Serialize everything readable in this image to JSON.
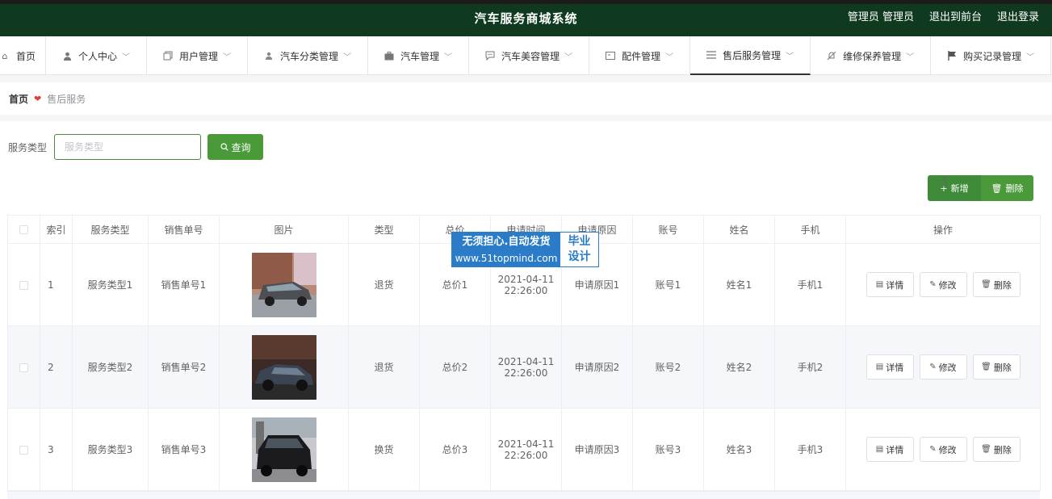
{
  "header": {
    "title": "汽车服务商城系统",
    "user_label": "管理员 管理员",
    "back_label": "退出到前台",
    "logout_label": "退出登录"
  },
  "nav": [
    {
      "label": "首页",
      "icon": "home-icon"
    },
    {
      "label": "个人中心",
      "icon": "user-icon"
    },
    {
      "label": "用户管理",
      "icon": "copy-icon"
    },
    {
      "label": "汽车分类管理",
      "icon": "user-icon"
    },
    {
      "label": "汽车管理",
      "icon": "briefcase-icon"
    },
    {
      "label": "汽车美容管理",
      "icon": "chat-icon"
    },
    {
      "label": "配件管理",
      "icon": "card-icon"
    },
    {
      "label": "售后服务管理",
      "icon": "menu-icon"
    },
    {
      "label": "维修保养管理",
      "icon": "bell-off-icon"
    },
    {
      "label": "购买记录管理",
      "icon": "flag-icon"
    }
  ],
  "breadcrumb": {
    "home": "首页",
    "current": "售后服务"
  },
  "search": {
    "label": "服务类型",
    "placeholder": "服务类型",
    "button": "查询"
  },
  "toolbar": {
    "add": "新增",
    "delete": "删除"
  },
  "table": {
    "headers": [
      "索引",
      "服务类型",
      "销售单号",
      "图片",
      "类型",
      "总价",
      "申请时间",
      "申请原因",
      "账号",
      "姓名",
      "手机",
      "操作"
    ],
    "rows": [
      {
        "index": "1",
        "service_type": "服务类型1",
        "order_no": "销售单号1",
        "image": "car-photo-silver-minivan",
        "type": "退货",
        "total": "总价1",
        "date": "2021-04-11",
        "time": "22:26:00",
        "reason": "申请原因1",
        "account": "账号1",
        "name": "姓名1",
        "phone": "手机1"
      },
      {
        "index": "2",
        "service_type": "服务类型2",
        "order_no": "销售单号2",
        "image": "car-photo-dark-sedan",
        "type": "退货",
        "total": "总价2",
        "date": "2021-04-11",
        "time": "22:26:00",
        "reason": "申请原因2",
        "account": "账号2",
        "name": "姓名2",
        "phone": "手机2"
      },
      {
        "index": "3",
        "service_type": "服务类型3",
        "order_no": "销售单号3",
        "image": "car-photo-black-suv",
        "type": "换货",
        "total": "总价3",
        "date": "2021-04-11",
        "time": "22:26:00",
        "reason": "申请原因3",
        "account": "账号3",
        "name": "姓名3",
        "phone": "手机3"
      }
    ],
    "ops": {
      "detail": "详情",
      "edit": "修改",
      "delete": "删除"
    }
  },
  "watermark": {
    "line1": "无须担心.自动发货",
    "line2": "www.51topmind.com",
    "right1": "毕业",
    "right2": "设计"
  },
  "colors": {
    "header_bg": "#0f3a1f",
    "primary": "#4a9a3a",
    "watermark": "#2a7bc8"
  }
}
